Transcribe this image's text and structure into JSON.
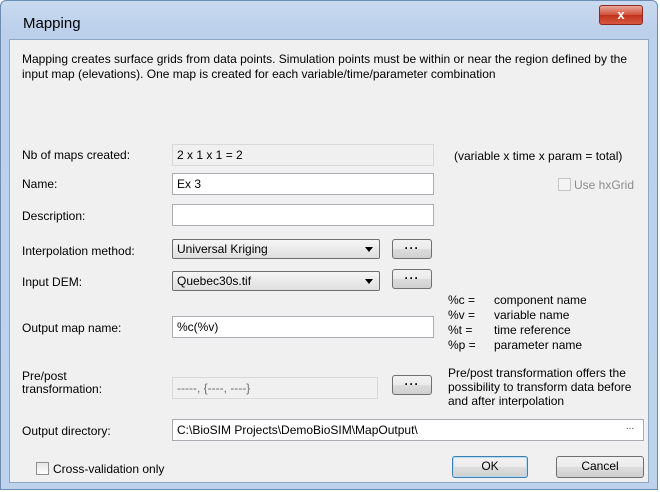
{
  "window": {
    "title": "Mapping",
    "close_glyph": "x"
  },
  "description": "Mapping creates surface grids from data points. Simulation points must be within or near the region defined by the input map (elevations). One map is created for each variable/time/parameter combination",
  "nb_maps": {
    "label": "Nb of maps created:",
    "value": "2 x 1 x 1 = 2",
    "hint": "(variable x time x param = total)"
  },
  "name": {
    "label": "Name:",
    "value": "Ex 3"
  },
  "use_hxgrid": {
    "label": "Use hxGrid",
    "checked": false,
    "enabled": false
  },
  "description_field": {
    "label": "Description:",
    "value": ""
  },
  "interpolation": {
    "label": "Interpolation method:",
    "value": "Universal Kriging",
    "button": "···"
  },
  "input_dem": {
    "label": "Input DEM:",
    "value": "Quebec30s.tif",
    "button": "···"
  },
  "output_map": {
    "label": "Output map name:",
    "value": "%c(%v)"
  },
  "legend": [
    {
      "code": "%c =",
      "meaning": "component name"
    },
    {
      "code": "%v =",
      "meaning": "variable name"
    },
    {
      "code": "%t =",
      "meaning": "time reference"
    },
    {
      "code": "%p =",
      "meaning": "parameter name"
    }
  ],
  "transformation": {
    "label_line1": "Pre/post",
    "label_line2": "transformation:",
    "value": "-----, {----, ----}",
    "button": "···",
    "note": "Pre/post transformation offers the possibility to transform data before and after interpolation"
  },
  "output_directory": {
    "label": "Output directory:",
    "value": "C:\\BioSIM Projects\\DemoBioSIM\\MapOutput\\",
    "button": "..."
  },
  "cross_validation": {
    "label": "Cross-validation only",
    "checked": false
  },
  "buttons": {
    "ok": "OK",
    "cancel": "Cancel"
  }
}
